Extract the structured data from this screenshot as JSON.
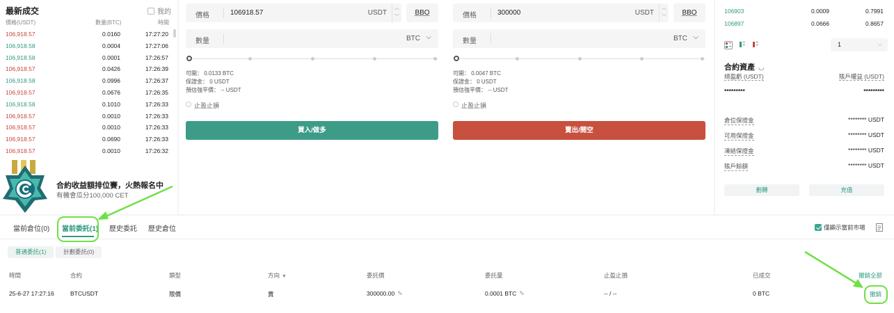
{
  "trades": {
    "title": "最新成交",
    "mine_label": "我的",
    "headers": [
      "價格(USDT)",
      "數量(BTC)",
      "時間"
    ],
    "rows": [
      {
        "price": "106,918.57",
        "qty": "0.0160",
        "time": "17:27:20",
        "side": "sell"
      },
      {
        "price": "106,918.58",
        "qty": "0.0004",
        "time": "17:27:06",
        "side": "buy"
      },
      {
        "price": "106,918.58",
        "qty": "0.0001",
        "time": "17:26:57",
        "side": "buy"
      },
      {
        "price": "106,918.57",
        "qty": "0.0426",
        "time": "17:26:39",
        "side": "sell"
      },
      {
        "price": "106,918.58",
        "qty": "0.0996",
        "time": "17:26:37",
        "side": "buy"
      },
      {
        "price": "106,918.57",
        "qty": "0.0676",
        "time": "17:26:35",
        "side": "sell"
      },
      {
        "price": "106,918.58",
        "qty": "0.1010",
        "time": "17:26:33",
        "side": "buy"
      },
      {
        "price": "106,918.57",
        "qty": "0.0010",
        "time": "17:26:33",
        "side": "sell"
      },
      {
        "price": "106,918.57",
        "qty": "0.0010",
        "time": "17:26:33",
        "side": "sell"
      },
      {
        "price": "106,918.57",
        "qty": "0.0690",
        "time": "17:26:33",
        "side": "sell"
      },
      {
        "price": "106,918.57",
        "qty": "0.0010",
        "time": "17:26:32",
        "side": "sell"
      }
    ]
  },
  "promo": {
    "title": "合約收益額排位賽，火熱報名中",
    "subtitle": "有機會瓜分100,000 CET"
  },
  "buy_form": {
    "price_label": "價格",
    "price_value": "106918.57",
    "price_unit": "USDT",
    "bbo": "BBO",
    "qty_label": "數量",
    "qty_unit": "BTC",
    "available": "可開： 0.0133 BTC",
    "margin": "保證金： 0 USDT",
    "liq": "預估強平價： -- USDT",
    "tpsl": "止盈止損",
    "button": "買入/做多"
  },
  "sell_form": {
    "price_label": "價格",
    "price_value": "300000",
    "price_unit": "USDT",
    "bbo": "BBO",
    "qty_label": "數量",
    "qty_unit": "BTC",
    "available": "可開： 0.0047 BTC",
    "margin": "保證金： 0 USDT",
    "liq": "預估強平價： -- USDT",
    "tpsl": "止盈止損",
    "button": "賣出/開空"
  },
  "orderbook": {
    "rows": [
      {
        "price": "106903",
        "qty": "0.0009",
        "total": "0.7991"
      },
      {
        "price": "106897",
        "qty": "0.0666",
        "total": "0.8657"
      }
    ],
    "precision": "1"
  },
  "assets": {
    "title": "合約資產",
    "total_pnl_label": "總盈虧 (USDT)",
    "equity_label": "賬戶權益 (USDT)",
    "total_pnl_value": "*********",
    "equity_value": "*********",
    "rows": [
      {
        "label": "倉位保證金",
        "value": "******** USDT"
      },
      {
        "label": "可用保證金",
        "value": "******** USDT"
      },
      {
        "label": "凍結保證金",
        "value": "******** USDT"
      },
      {
        "label": "賬戶餘額",
        "value": "******** USDT"
      }
    ],
    "transfer": "劃轉",
    "deposit": "充值"
  },
  "tabs": {
    "positions": "當前倉位(0)",
    "open_orders": "當前委託(1)",
    "order_history": "歷史委託",
    "position_history": "歷史倉位",
    "current_market_only": "僅顯示當前市場"
  },
  "subtabs": {
    "normal": "普通委託(1)",
    "plan": "計劃委託(0)"
  },
  "orders": {
    "headers": {
      "time": "時間",
      "contract": "合約",
      "type": "類型",
      "side": "方向",
      "price": "委託價",
      "amount": "委託量",
      "tpsl": "止盈止損",
      "filled": "已成交",
      "cancel_all": "撤銷全部"
    },
    "row": {
      "time": "25-6-27 17:27:16",
      "contract": "BTCUSDT",
      "type": "限價",
      "side": "賣",
      "price": "300000.00",
      "amount": "0.0001 BTC",
      "tpsl": "-- / --",
      "filled": "0 BTC",
      "cancel": "撤銷"
    }
  },
  "colors": {
    "buy": "#2f9a7f",
    "sell": "#c8453a",
    "highlight": "#6fe045"
  }
}
